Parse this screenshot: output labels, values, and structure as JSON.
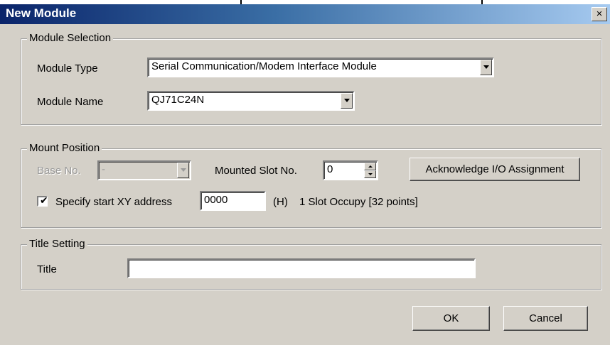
{
  "window": {
    "title": "New Module",
    "close_symbol": "×"
  },
  "module_selection": {
    "group_label": "Module Selection",
    "type_label": "Module Type",
    "type_value": "Serial Communication/Modem Interface Module",
    "name_label": "Module Name",
    "name_value": "QJ71C24N"
  },
  "mount_position": {
    "group_label": "Mount Position",
    "base_label": "Base No.",
    "base_value": "-",
    "slot_label": "Mounted Slot No.",
    "slot_value": "0",
    "ack_button": "Acknowledge I/O Assignment",
    "specify_label": "Specify start XY address",
    "specify_checked": true,
    "xy_value": "0000",
    "hex_suffix": "(H)",
    "occupy_text": "1 Slot Occupy [32 points]"
  },
  "title_setting": {
    "group_label": "Title Setting",
    "title_label": "Title",
    "title_value": ""
  },
  "buttons": {
    "ok": "OK",
    "cancel": "Cancel"
  },
  "icons": {
    "close": "close-icon",
    "dropdown": "chevron-down-icon",
    "spin": "spinner-arrows-icon",
    "check": "checkmark-icon"
  },
  "colors": {
    "title_gradient_start": "#0a246a",
    "title_gradient_end": "#a6caf0",
    "dialog_bg": "#d4d0c8"
  }
}
